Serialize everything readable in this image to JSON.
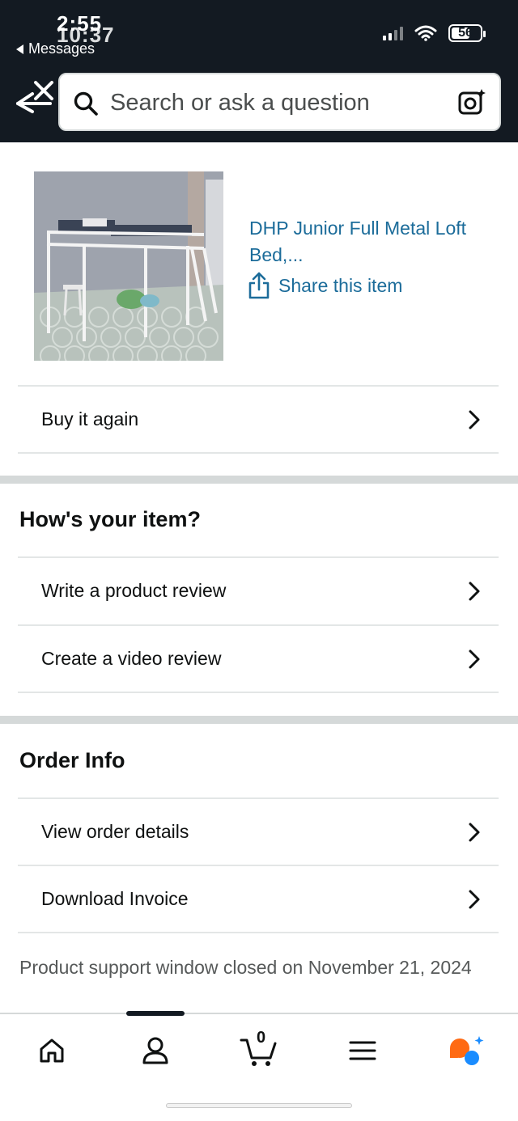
{
  "status_bar": {
    "time": "2:55",
    "time_ghost": "10:37",
    "back_app": "Messages",
    "battery": "56"
  },
  "search": {
    "placeholder": "Search or ask a question"
  },
  "product": {
    "title": "DHP Junior Full Metal Loft Bed,...",
    "share_label": "Share this item"
  },
  "actions": {
    "buy_again": "Buy it again"
  },
  "review_section": {
    "title": "How's your item?",
    "write_review": "Write a product review",
    "video_review": "Create a video review"
  },
  "order_section": {
    "title": "Order Info",
    "view_details": "View order details",
    "download_invoice": "Download Invoice"
  },
  "support_note": "Product support window closed on November 21, 2024",
  "bottom_nav": {
    "cart_count": "0",
    "icons": [
      "home-icon",
      "account-icon",
      "cart-icon",
      "menu-icon",
      "rufus-assistant-icon"
    ]
  },
  "colors": {
    "header_bg": "#131a22",
    "link": "#1c6c9a",
    "rufus_orange": "#ff6a13",
    "rufus_blue": "#1a8cff"
  }
}
